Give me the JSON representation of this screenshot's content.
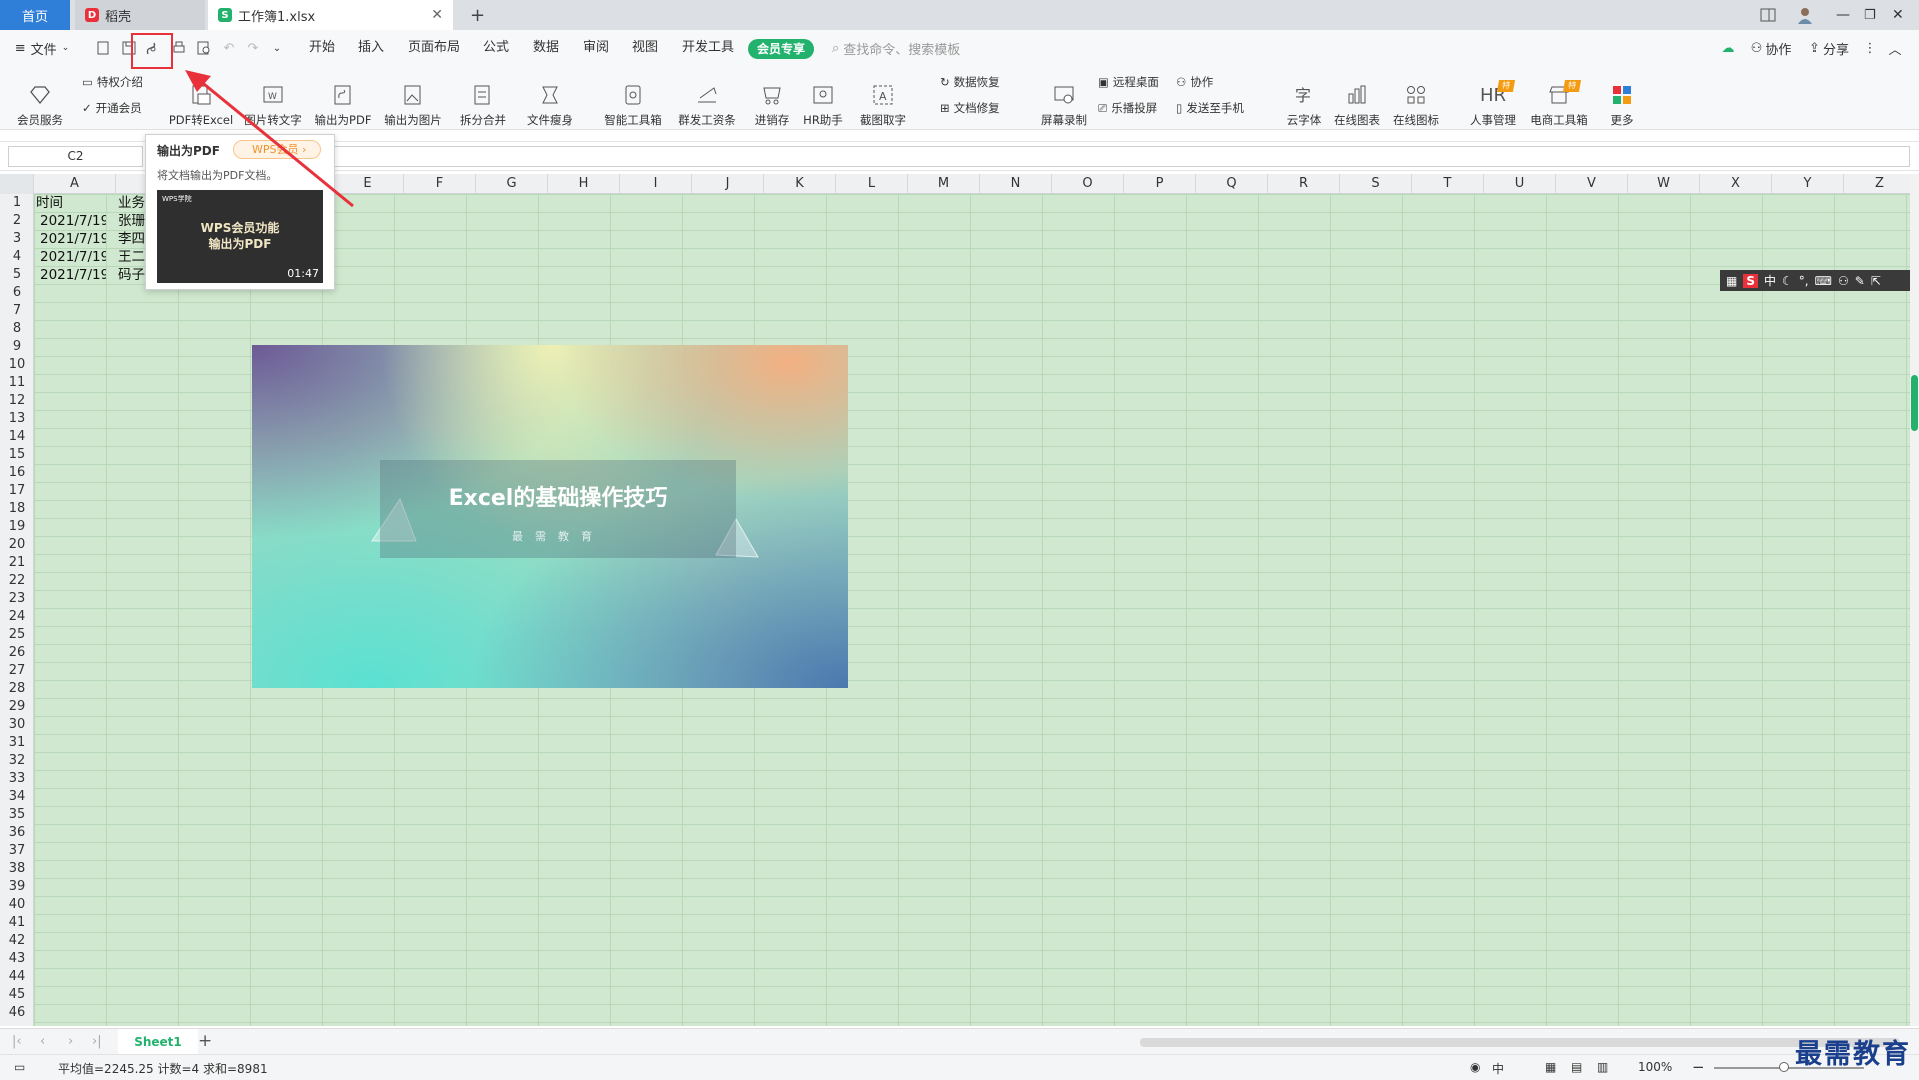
{
  "tabs": {
    "home": "首页",
    "daoke": "稻壳",
    "workbook": "工作簿1.xlsx",
    "new_tab": "+"
  },
  "toolbar": {
    "file_menu": "文件",
    "menu_tabs": [
      "开始",
      "插入",
      "页面布局",
      "公式",
      "数据",
      "审阅",
      "视图",
      "开发工具"
    ],
    "vip_tab": "会员专享",
    "search_placeholder": "查找命令、搜索模板",
    "collab": "协作",
    "share": "分享"
  },
  "ribbon": {
    "privilege_intro": "特权介绍",
    "open_vip": "开通会员",
    "vip_service": "会员服务",
    "pdf_to_excel": "PDF转Excel",
    "image_to_text": "图片转文字",
    "export_pdf": "输出为PDF",
    "export_image": "输出为图片",
    "split_merge": "拆分合并",
    "file_slim": "文件瘦身",
    "smart_toolbox": "智能工具箱",
    "mass_pay": "群发工资条",
    "inventory": "进销存",
    "hr_assistant": "HR助手",
    "screenshot_ocr": "截图取字",
    "data_recovery": "数据恢复",
    "doc_repair": "文档修复",
    "screen_record": "屏幕录制",
    "remote_desktop": "远程桌面",
    "collab2": "协作",
    "cast_screen": "乐播投屏",
    "send_phone": "发送至手机",
    "cloud_font": "云字体",
    "online_chart": "在线图表",
    "online_icon": "在线图标",
    "hr_manage": "人事管理",
    "ecommerce": "电商工具箱",
    "more": "更多",
    "badge_te": "特"
  },
  "formula": {
    "name_box": "C2"
  },
  "columns": [
    "A",
    "B",
    "C",
    "D",
    "E",
    "F",
    "G",
    "H",
    "I",
    "J",
    "K",
    "L",
    "M",
    "N",
    "O",
    "P",
    "Q",
    "R",
    "S",
    "T",
    "U",
    "V",
    "W",
    "X",
    "Y",
    "Z"
  ],
  "rows": [
    "1",
    "2",
    "3",
    "4",
    "5",
    "6",
    "7",
    "8",
    "9",
    "10",
    "11",
    "12",
    "13",
    "14",
    "15",
    "16",
    "17",
    "18",
    "19",
    "20",
    "21",
    "22",
    "23",
    "24",
    "25",
    "26",
    "27",
    "28",
    "29",
    "30",
    "31",
    "32",
    "33",
    "34",
    "35",
    "36",
    "37",
    "38",
    "39",
    "40",
    "41",
    "42",
    "43",
    "44",
    "45",
    "46"
  ],
  "cells": {
    "A1": "时间",
    "B1": "业务",
    "A2": "2021/7/19",
    "B2": "张珊",
    "A3": "2021/7/19",
    "B3": "李四",
    "A4": "2021/7/19",
    "B4": "王二",
    "A5": "2021/7/19",
    "B5": "码子"
  },
  "banner": {
    "title": "Excel的基础操作技巧",
    "subtitle": "最需教育"
  },
  "tooltip": {
    "title": "输出为PDF",
    "badge": "WPS会员",
    "desc": "将文档输出为PDF文档。",
    "video_brand": "WPS学院",
    "video_title_1": "WPS会员功能",
    "video_title_2": "输出为PDF",
    "duration": "01:47"
  },
  "ime": {
    "lang": "中"
  },
  "sheets": {
    "active": "Sheet1",
    "add": "+"
  },
  "status": {
    "summary": "平均值=2245.25  计数=4  求和=8981",
    "zoom": "100%",
    "input_mode": "中"
  },
  "watermark": "最需教育",
  "colors": {
    "accent": "#23b26d",
    "tab_active": "#2f7ed8",
    "highlight": "#e8313a",
    "grid_bg": "#cfe8cf"
  }
}
